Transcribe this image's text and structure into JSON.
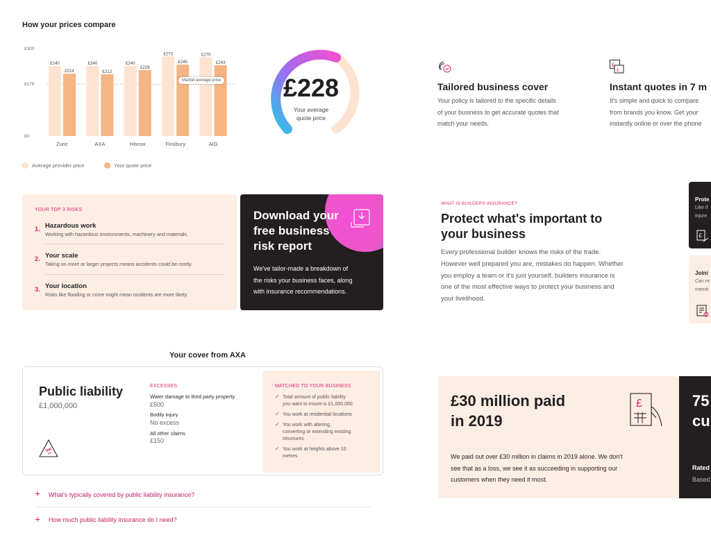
{
  "chart": {
    "title": "How your prices compare",
    "annotation": "Market average price",
    "legend": [
      {
        "label": "Average provider price",
        "color": "#fde3d0"
      },
      {
        "label": "Your quote price",
        "color": "#f4b584"
      }
    ]
  },
  "chart_data": {
    "type": "bar",
    "title": "How your prices compare",
    "categories": [
      "Zuric",
      "AXA",
      "Hiscox",
      "Finsbury",
      "AIG"
    ],
    "series": [
      {
        "name": "Average provider price",
        "values": [
          240,
          240,
          240,
          273,
          270
        ]
      },
      {
        "name": "Your quote price",
        "values": [
          214,
          212,
          226,
          245,
          243
        ]
      }
    ],
    "yticks": [
      "£0",
      "£178",
      "£300"
    ],
    "ytick_values": [
      0,
      178,
      300
    ],
    "ylim": [
      0,
      300
    ],
    "reference_line": {
      "label": "Market average price",
      "value": 178
    },
    "legend_position": "bottom-left",
    "colors": [
      "#fde3d0",
      "#f4b584"
    ]
  },
  "gauge": {
    "price": "£228",
    "caption_line1": "Your average",
    "caption_line2": "quote price"
  },
  "features": [
    {
      "title": "Tailored business cover",
      "lines": [
        "Your policy is tailored to the specific details",
        "of your business to get accurate quotes that",
        "match your needs."
      ],
      "icon": "tailored-cover-icon"
    },
    {
      "title": "Instant quotes in 7 m",
      "lines": [
        "It's simple and quick to compare",
        "from brands you know. Get your",
        "instantly online or over the phone"
      ],
      "icon": "instant-quote-icon"
    }
  ],
  "risks": {
    "heading": "YOUR TOP 3 RISKS",
    "items": [
      {
        "num": "1.",
        "title": "Hazardous work",
        "desc": "Working with hazardous environments, machinery and materials."
      },
      {
        "num": "2.",
        "title": "Your scale",
        "desc": "Taking on more or larger projects means accidents could be costly."
      },
      {
        "num": "3.",
        "title": "Your location",
        "desc": "Risks like flooding or crime might mean incidents are more likely."
      }
    ]
  },
  "download": {
    "title_line1": "Download your",
    "title_line2": "free business",
    "title_line3": "risk report",
    "text_line1": "We've tailor-made a breakdown of",
    "text_line2": "the risks your business faces, along",
    "text_line3": "with insurance recommendations."
  },
  "builders": {
    "eyebrow": "WHAT IS BUILDERS INSURANCE?",
    "title_line1": "Protect what's important to",
    "title_line2": "your business",
    "lines": [
      "Every professional builder knows the risks of the trade.",
      "However well prepared you are, mistakes do happen. Whether",
      "you employ a team or it's just yourself, builders insurance is",
      "one of the most effective ways to protect your business and",
      "your livelihood."
    ]
  },
  "edge_cards": [
    {
      "title": "Prote",
      "lines": [
        "Like if",
        "injure"
      ]
    },
    {
      "title": "Joini",
      "lines": [
        "Can re",
        "memb"
      ]
    }
  ],
  "cover": {
    "heading": "Your cover from AXA",
    "title": "Public liability",
    "amount": "£1,000,000",
    "excesses_label": "EXCESSES",
    "excesses": [
      {
        "label": "Water damage to third party property",
        "value": "£500"
      },
      {
        "label": "Bodily injury",
        "value": "No excess"
      },
      {
        "label": "All other claims",
        "value": "£150"
      }
    ],
    "matched_label": "MATCHED TO YOUR BUSINESS",
    "matched": [
      [
        "Total amount of public liability",
        "you want to insure is £1,000,000"
      ],
      [
        "You work at residential locations"
      ],
      [
        "You work with altering,",
        "converting or extending existing",
        "structures"
      ],
      [
        "You work at heights above 10",
        "metres"
      ]
    ]
  },
  "faq": [
    {
      "question": "What's typically covered by public liability insurance?"
    },
    {
      "question": "How much public liability insurance do I need?"
    }
  ],
  "claims": {
    "title_line1": "£30 million paid",
    "title_line2": "in 2019",
    "text_line1": "We paid out over £30 million in claims in 2019 alone. We don't",
    "text_line2": "see that as a loss, we see it as succeeding in supporting our",
    "text_line3": "customers when they need it most."
  },
  "dark_panel": {
    "big_line1": "75",
    "big_line2": "cu",
    "rated": "Rated",
    "based": "Based"
  },
  "colors": {
    "accent": "#e0236f",
    "peach": "#fdeee4",
    "dark": "#231f20",
    "avg_bar": "#fde3d0",
    "quote_bar": "#f4b584"
  }
}
